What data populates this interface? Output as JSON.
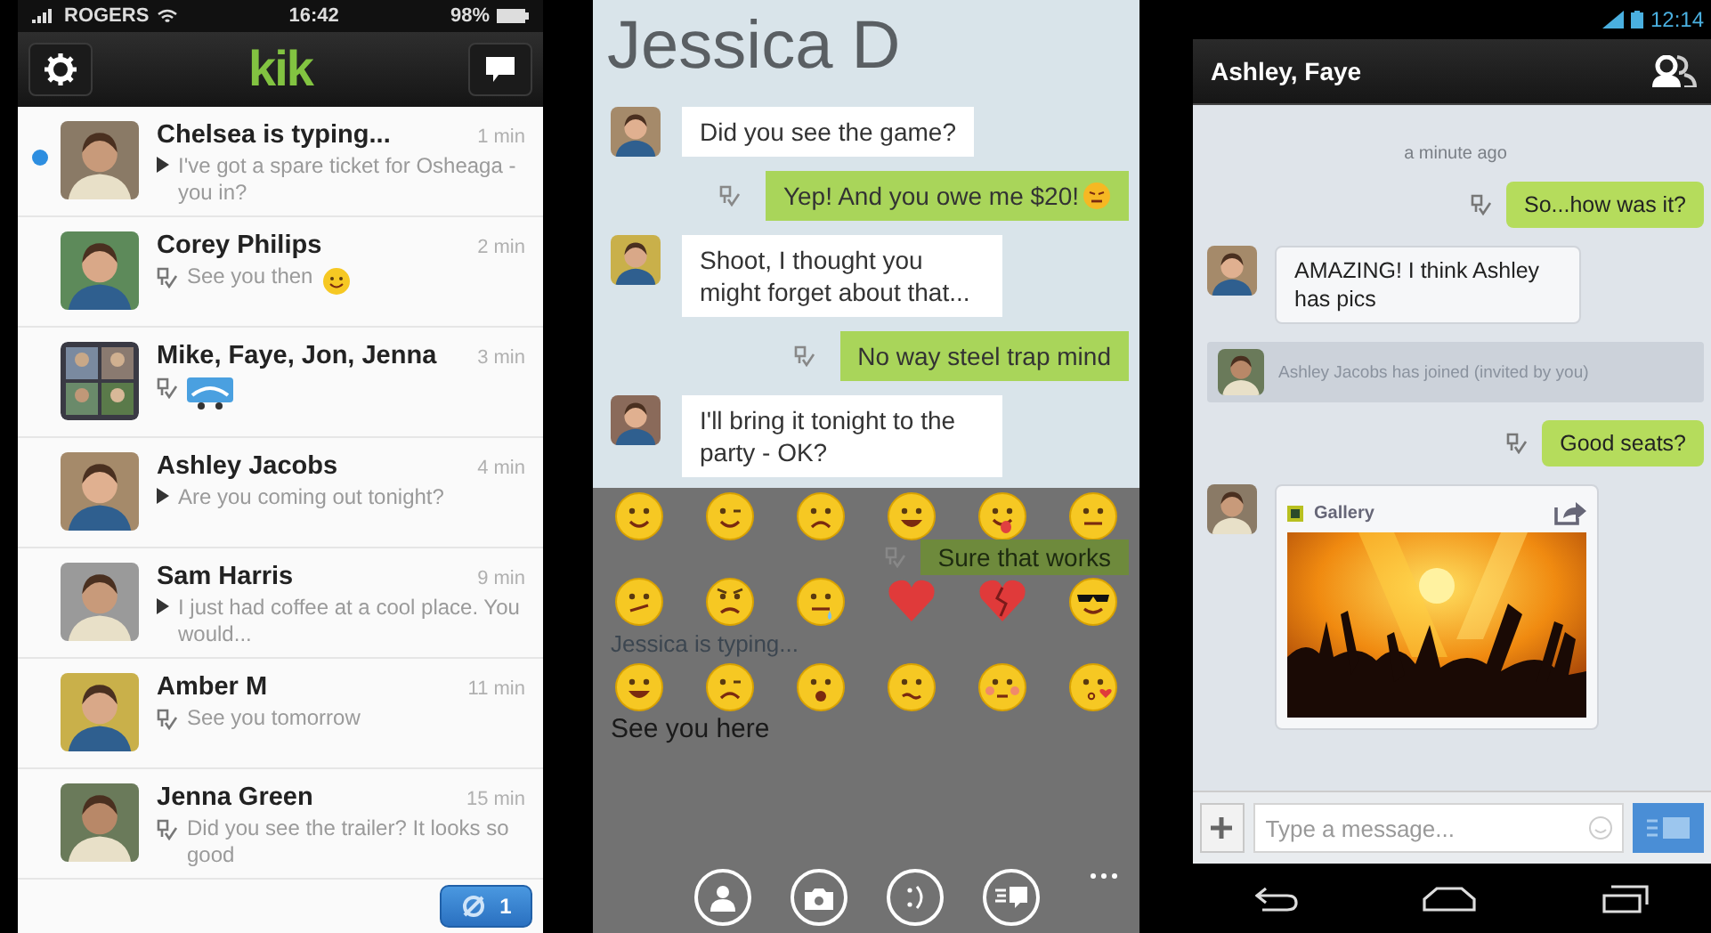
{
  "conversation_list": {
    "status_bar": {
      "carrier": "ROGERS",
      "time": "16:42",
      "battery": "98%"
    },
    "logo": "kik",
    "conversations": [
      {
        "kind": "single",
        "name": "Chelsea is typing...",
        "time": "1 min",
        "preview": "I've got a spare ticket for Osheaga - you in?",
        "read": false,
        "emoji": false,
        "sticker": false,
        "unread": true
      },
      {
        "kind": "single",
        "name": "Corey Philips",
        "time": "2 min",
        "preview": "See you then",
        "read": true,
        "emoji": true,
        "sticker": false,
        "unread": false
      },
      {
        "kind": "group",
        "name": "Mike, Faye, Jon, Jenna",
        "time": "3 min",
        "read": true,
        "emoji": false,
        "sticker": true,
        "unread": false
      },
      {
        "kind": "single",
        "name": "Ashley Jacobs",
        "time": "4 min",
        "preview": "Are you coming out tonight?",
        "read": false,
        "emoji": false,
        "sticker": false,
        "unread": false
      },
      {
        "kind": "single",
        "name": "Sam Harris",
        "time": "9 min",
        "preview": "I just had coffee at a cool place. You would...",
        "read": false,
        "emoji": false,
        "sticker": false,
        "unread": false
      },
      {
        "kind": "single",
        "name": "Amber M",
        "time": "11 min",
        "preview": "See you tomorrow",
        "read": true,
        "emoji": false,
        "sticker": false,
        "unread": false
      },
      {
        "kind": "single",
        "name": "Jenna Green",
        "time": "15 min",
        "preview": "Did you see the trailer? It looks so good",
        "read": true,
        "emoji": false,
        "sticker": false,
        "unread": false
      }
    ],
    "new_badge": "1"
  },
  "jessica_chat": {
    "title": "Jessica D",
    "messages": [
      {
        "kind": "received",
        "text": "Did you see the game?",
        "emoji": false
      },
      {
        "kind": "sent",
        "text": "Yep! And you owe me $20!",
        "emoji": true
      },
      {
        "kind": "received",
        "text": "Shoot, I thought you might forget about that...",
        "emoji": false
      },
      {
        "kind": "sent",
        "text": "No way steel trap mind",
        "emoji": false
      },
      {
        "kind": "received",
        "text": "I'll bring it tonight to the party - OK?",
        "emoji": false
      }
    ],
    "emoji_panel": {
      "emojis": [
        {
          "kind": "smile"
        },
        {
          "kind": "wink"
        },
        {
          "kind": "sad"
        },
        {
          "kind": "grin"
        },
        {
          "kind": "tongue"
        },
        {
          "kind": "neutral"
        },
        {
          "kind": "smirk"
        },
        {
          "kind": "angry"
        },
        {
          "kind": "drool"
        },
        {
          "kind": "heart"
        },
        {
          "kind": "broken_heart"
        },
        {
          "kind": "cool"
        },
        {
          "kind": "happy"
        },
        {
          "kind": "tired"
        },
        {
          "kind": "surprised"
        },
        {
          "kind": "worried"
        },
        {
          "kind": "blush"
        },
        {
          "kind": "kiss"
        }
      ],
      "sent_reply": "Sure that works",
      "typing": "Jessica is typing...",
      "draft": "See you here"
    }
  },
  "group_chat": {
    "status_bar": {
      "time": "12:14"
    },
    "title": "Ashley, Faye",
    "messages": [
      {
        "kind": "timestamp",
        "text": "a minute ago"
      },
      {
        "kind": "sent",
        "text": "So...how was it?"
      },
      {
        "kind": "received",
        "text": "AMAZING! I think Ashley has pics"
      },
      {
        "kind": "system",
        "text": "Ashley Jacobs has joined (invited by you)"
      },
      {
        "kind": "sent",
        "text": "Good seats?"
      },
      {
        "source": "Gallery"
      }
    ],
    "input": {
      "placeholder": "Type a message..."
    }
  }
}
